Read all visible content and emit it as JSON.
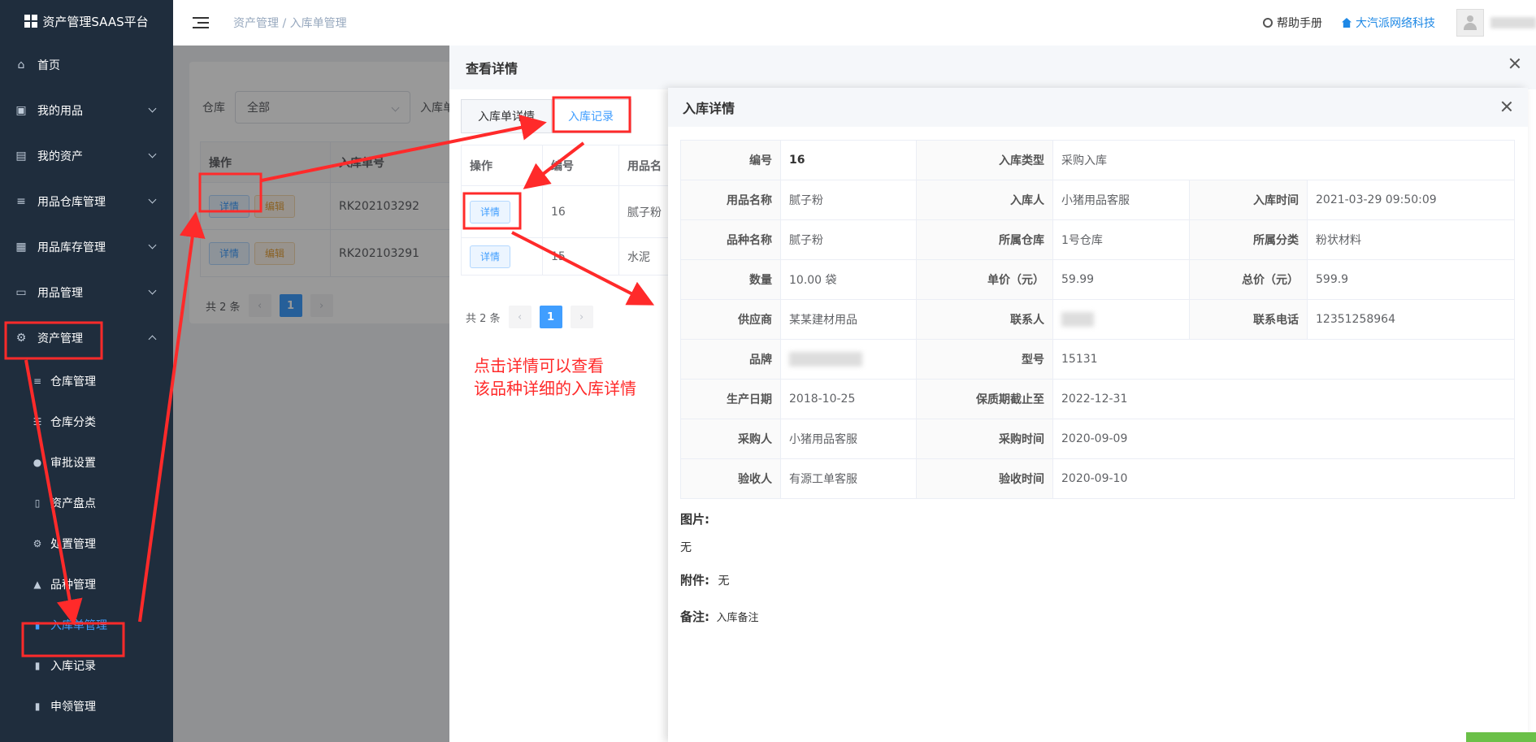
{
  "brand": {
    "title": "资产管理SAAS平台"
  },
  "sidebar": {
    "items": [
      {
        "label": "首页",
        "icon": "home-icon"
      },
      {
        "label": "我的用品",
        "icon": "bag-icon"
      },
      {
        "label": "我的资产",
        "icon": "building-icon"
      },
      {
        "label": "用品仓库管理",
        "icon": "database-icon"
      },
      {
        "label": "用品库存管理",
        "icon": "box-icon"
      },
      {
        "label": "用品管理",
        "icon": "inbox-icon"
      },
      {
        "label": "资产管理",
        "icon": "gear-icon"
      }
    ],
    "subitems": [
      {
        "label": "仓库管理"
      },
      {
        "label": "仓库分类"
      },
      {
        "label": "审批设置"
      },
      {
        "label": "资产盘点"
      },
      {
        "label": "处置管理"
      },
      {
        "label": "品种管理"
      },
      {
        "label": "入库单管理"
      },
      {
        "label": "入库记录"
      },
      {
        "label": "申领管理"
      }
    ]
  },
  "header": {
    "breadcrumb": "资产管理 / 入库单管理",
    "help": "帮助手册",
    "company": "大汽派网络科技"
  },
  "main": {
    "filter_label": "仓库",
    "filter_value": "全部",
    "filter_label2": "入库单",
    "table": {
      "headers": [
        "操作",
        "入库单号"
      ],
      "rows": [
        {
          "no": "RK202103292",
          "detail": "详情",
          "edit": "编辑"
        },
        {
          "no": "RK202103291",
          "detail": "详情",
          "edit": "编辑"
        }
      ]
    },
    "pager": {
      "total": "共 2 条",
      "page": "1"
    }
  },
  "drawer1": {
    "title": "查看详情",
    "tabs": [
      "入库单详情",
      "入库记录"
    ],
    "table": {
      "headers": [
        "操作",
        "编号",
        "用品名"
      ],
      "rows": [
        {
          "detail": "详情",
          "no": "16",
          "name": "腻子粉"
        },
        {
          "detail": "详情",
          "no": "15",
          "name": "水泥"
        }
      ]
    },
    "pager": {
      "total": "共 2 条",
      "page": "1"
    },
    "annotation_line1": "点击详情可以查看",
    "annotation_line2": "该品种详细的入库详情"
  },
  "drawer2": {
    "title": "入库详情",
    "rows": [
      {
        "l1": "编号",
        "v1": "16",
        "l2": "入库类型",
        "v2": "采购入库"
      },
      {
        "l1": "用品名称",
        "v1": "腻子粉",
        "l2": "入库人",
        "v2": "小猪用品客服",
        "l3": "入库时间",
        "v3": "2021-03-29 09:50:09"
      },
      {
        "l1": "品种名称",
        "v1": "腻子粉",
        "l2": "所属仓库",
        "v2": "1号仓库",
        "l3": "所属分类",
        "v3": "粉状材料"
      },
      {
        "l1": "数量",
        "v1": "10.00 袋",
        "l2": "单价（元）",
        "v2": "59.99",
        "l3": "总价（元）",
        "v3": "599.9"
      },
      {
        "l1": "供应商",
        "v1": "某某建材用品",
        "l2": "联系人",
        "v2": "",
        "l3": "联系电话",
        "v3": "12351258964"
      },
      {
        "l1": "品牌",
        "v1": "",
        "l2": "型号",
        "v2": "15131"
      },
      {
        "l1": "生产日期",
        "v1": "2018-10-25",
        "l2": "保质期截止至",
        "v2": "2022-12-31"
      },
      {
        "l1": "采购人",
        "v1": "小猪用品客服",
        "l2": "采购时间",
        "v2": "2020-09-09"
      },
      {
        "l1": "验收人",
        "v1": "有源工单客服",
        "l2": "验收时间",
        "v2": "2020-09-10"
      }
    ],
    "image_label": "图片:",
    "image_value": "无",
    "attach_label": "附件:",
    "attach_value": "无",
    "remark_label": "备注:",
    "remark_value": "入库备注"
  }
}
